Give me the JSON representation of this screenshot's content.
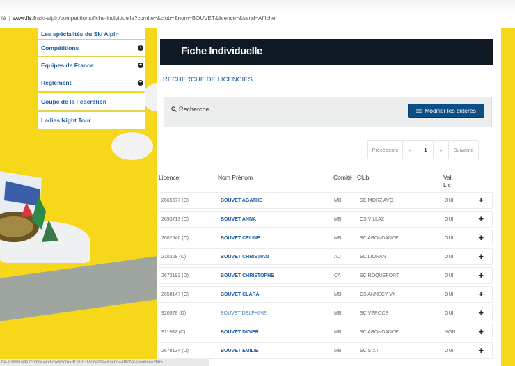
{
  "browser": {
    "prefix": "ié",
    "host": "www.ffs.fr",
    "path": "/ski-alpin/competitions/fiche-individuelle?comite=&club=&nom=BOUVET&licence=&send=Afficher",
    "status_text": "he-individuelle?comite=&club=&nom=BOUVET&licence=&send=Afficher&licence=2665..."
  },
  "sidebar": {
    "items": [
      {
        "label": "Les spécialités du Ski Alpin",
        "has_plus": false
      },
      {
        "label": "Compétitions",
        "has_plus": true
      },
      {
        "label": "Equipes de France",
        "has_plus": true
      },
      {
        "label": "Reglement",
        "has_plus": true
      },
      {
        "label": "Coupe de la Fédération",
        "has_plus": false
      },
      {
        "label": "Ladies Night Tour",
        "has_plus": false
      }
    ]
  },
  "main": {
    "title": "Fiche Individuelle",
    "subtitle": "RECHERCHE DE LICENCIÉS",
    "search_label": "Recherche",
    "modify_button": "Modifier les critères"
  },
  "pagination": {
    "prev": "Précédente",
    "first": "«",
    "current": "1",
    "next_arrow": "»",
    "next": "Suivante"
  },
  "table": {
    "headers": {
      "licence": "Licence",
      "name": "Nom Prénom",
      "comite": "Comité",
      "club": "Club",
      "val": "Val.",
      "lic": "Lic"
    },
    "rows": [
      {
        "licence": "2665677 (C)",
        "name": "BOUVET AGATHE",
        "comite": "MB",
        "club": "SC MORZ AVO",
        "val": "OUI"
      },
      {
        "licence": "2693713 (C)",
        "name": "BOUVET ANNA",
        "comite": "MB",
        "club": "CS VILLAZ",
        "val": "OUI"
      },
      {
        "licence": "2602546 (C)",
        "name": "BOUVET CELINE",
        "comite": "MB",
        "club": "SC ABONDANCE",
        "val": "OUI"
      },
      {
        "licence": "210308 (C)",
        "name": "BOUVET CHRISTIAN",
        "comite": "AU",
        "club": "SC LIORAN",
        "val": "OUI"
      },
      {
        "licence": "2673193 (D)",
        "name": "BOUVET CHRISTOPHE",
        "comite": "CA",
        "club": "SC ROQUEFORT",
        "val": "OUI"
      },
      {
        "licence": "2658147 (C)",
        "name": "BOUVET CLARA",
        "comite": "MB",
        "club": "CS ANNECY VX",
        "val": "OUI"
      },
      {
        "licence": "920578 (D)",
        "name": "BOUVET DELPHINE",
        "comite": "MB",
        "club": "SC VEROCE",
        "val": "OUI"
      },
      {
        "licence": "911992 (C)",
        "name": "BOUVET DIDIER",
        "comite": "MB",
        "club": "SC ABONDANCE",
        "val": "NON"
      },
      {
        "licence": "2678134 (D)",
        "name": "BOUVET EMILIE",
        "comite": "MB",
        "club": "SC SIXT",
        "val": "OUI"
      }
    ],
    "add_symbol": "+"
  },
  "colors": {
    "background": "#f7d71a",
    "link_blue": "#1a5ca5",
    "title_bar": "#0f1a24",
    "button": "#0c4f86"
  }
}
